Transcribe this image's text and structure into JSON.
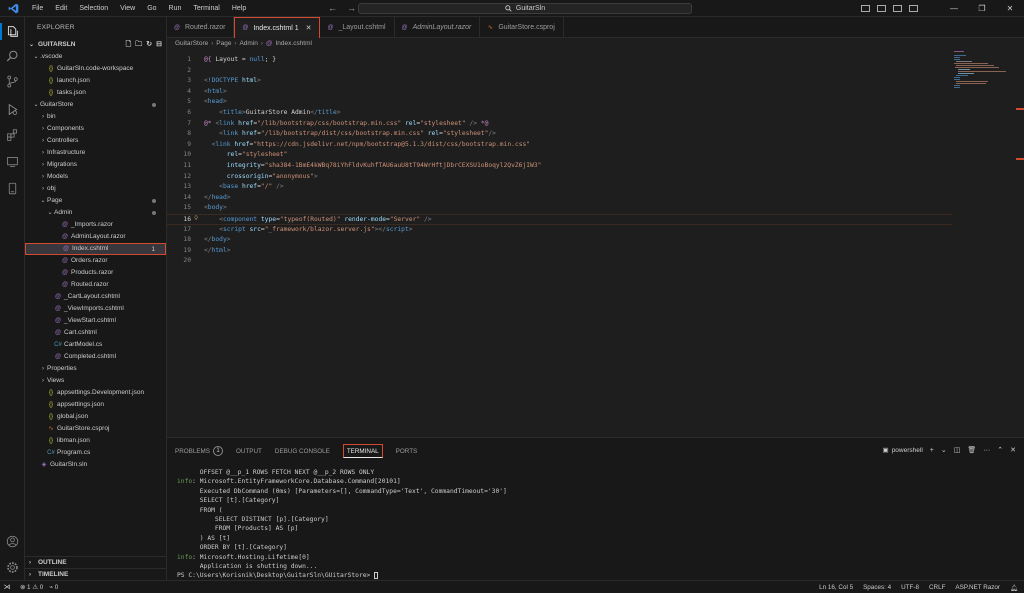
{
  "titlebar": {
    "menu": [
      "File",
      "Edit",
      "Selection",
      "View",
      "Go",
      "Run",
      "Terminal",
      "Help"
    ],
    "search_text": "GuitarSln"
  },
  "sidebar": {
    "title": "EXPLORER",
    "root": "GUITARSLN",
    "tree": [
      {
        "label": ".vscode",
        "depth": 1,
        "type": "folder-open"
      },
      {
        "label": "GuitarSln.code-workspace",
        "depth": 2,
        "type": "braces"
      },
      {
        "label": "launch.json",
        "depth": 2,
        "type": "braces"
      },
      {
        "label": "tasks.json",
        "depth": 2,
        "type": "braces"
      },
      {
        "label": "GuitarStore",
        "depth": 1,
        "type": "folder-open",
        "dot": true
      },
      {
        "label": "bin",
        "depth": 2,
        "type": "folder"
      },
      {
        "label": "Components",
        "depth": 2,
        "type": "folder"
      },
      {
        "label": "Controllers",
        "depth": 2,
        "type": "folder"
      },
      {
        "label": "Infrastructure",
        "depth": 2,
        "type": "folder"
      },
      {
        "label": "Migrations",
        "depth": 2,
        "type": "folder"
      },
      {
        "label": "Models",
        "depth": 2,
        "type": "folder"
      },
      {
        "label": "obj",
        "depth": 2,
        "type": "folder"
      },
      {
        "label": "Page",
        "depth": 2,
        "type": "folder-open",
        "dot": true
      },
      {
        "label": "Admin",
        "depth": 3,
        "type": "folder-open",
        "dot": true
      },
      {
        "label": "_Imports.razor",
        "depth": 4,
        "type": "file"
      },
      {
        "label": "AdminLayout.razor",
        "depth": 4,
        "type": "file"
      },
      {
        "label": "Index.cshtml",
        "depth": 4,
        "type": "file",
        "selected": true,
        "badge": "1"
      },
      {
        "label": "Orders.razor",
        "depth": 4,
        "type": "file"
      },
      {
        "label": "Products.razor",
        "depth": 4,
        "type": "file"
      },
      {
        "label": "Routed.razor",
        "depth": 4,
        "type": "file"
      },
      {
        "label": "_CartLayout.cshtml",
        "depth": 3,
        "type": "file"
      },
      {
        "label": "_ViewImports.cshtml",
        "depth": 3,
        "type": "file"
      },
      {
        "label": "_ViewStart.cshtml",
        "depth": 3,
        "type": "file"
      },
      {
        "label": "Cart.cshtml",
        "depth": 3,
        "type": "file"
      },
      {
        "label": "CartModel.cs",
        "depth": 3,
        "type": "cs"
      },
      {
        "label": "Completed.cshtml",
        "depth": 3,
        "type": "file"
      },
      {
        "label": "Properties",
        "depth": 2,
        "type": "folder"
      },
      {
        "label": "Views",
        "depth": 2,
        "type": "folder"
      },
      {
        "label": "appsettings.Development.json",
        "depth": 2,
        "type": "braces"
      },
      {
        "label": "appsettings.json",
        "depth": 2,
        "type": "braces"
      },
      {
        "label": "global.json",
        "depth": 2,
        "type": "braces"
      },
      {
        "label": "GuitarStore.csproj",
        "depth": 2,
        "type": "rss"
      },
      {
        "label": "libman.json",
        "depth": 2,
        "type": "braces"
      },
      {
        "label": "Program.cs",
        "depth": 2,
        "type": "cs"
      },
      {
        "label": "GuitarSln.sln",
        "depth": 1,
        "type": "sln"
      }
    ],
    "outline": "OUTLINE",
    "timeline": "TIMELINE"
  },
  "tabs": [
    {
      "label": "Routed.razor",
      "active": false,
      "italic": false
    },
    {
      "label": "Index.cshtml 1",
      "active": true,
      "italic": false
    },
    {
      "label": "_Layout.cshtml",
      "active": false,
      "italic": false
    },
    {
      "label": "AdminLayout.razor",
      "active": false,
      "italic": true
    },
    {
      "label": "GuitarStore.csproj",
      "active": false,
      "italic": false
    }
  ],
  "breadcrumb": [
    "GuitarStore",
    "Page",
    "Admin",
    "Index.cshtml"
  ],
  "editor": {
    "current_line": 16,
    "lines": [
      [
        [
          "raz",
          "@{ "
        ],
        [
          "t",
          "Layout = "
        ],
        [
          "kw",
          "null"
        ],
        [
          "t",
          "; }"
        ]
      ],
      [],
      [
        [
          "p",
          "<"
        ],
        [
          "tag",
          "!DOCTYPE"
        ],
        [
          "t",
          " "
        ],
        [
          "attr",
          "html"
        ],
        [
          "p",
          ">"
        ]
      ],
      [
        [
          "p",
          "<"
        ],
        [
          "tag",
          "html"
        ],
        [
          "p",
          ">"
        ]
      ],
      [
        [
          "p",
          "<"
        ],
        [
          "tag",
          "head"
        ],
        [
          "p",
          ">"
        ]
      ],
      [
        [
          "t",
          "    "
        ],
        [
          "p",
          "<"
        ],
        [
          "tag",
          "title"
        ],
        [
          "p",
          ">"
        ],
        [
          "t",
          "GuitarStore Admin"
        ],
        [
          "p",
          "</"
        ],
        [
          "tag",
          "title"
        ],
        [
          "p",
          ">"
        ]
      ],
      [
        [
          "raz",
          "@* "
        ],
        [
          "p",
          "<"
        ],
        [
          "tag",
          "link"
        ],
        [
          "t",
          " "
        ],
        [
          "attr",
          "href"
        ],
        [
          "t",
          "="
        ],
        [
          "str",
          "\"/lib/bootstrap/css/bootstrap.min.css\""
        ],
        [
          "t",
          " "
        ],
        [
          "attr",
          "rel"
        ],
        [
          "t",
          "="
        ],
        [
          "str",
          "\"stylesheet\""
        ],
        [
          "t",
          " "
        ],
        [
          "p",
          "/>"
        ],
        [
          "t",
          " "
        ],
        [
          "raz",
          "*@"
        ]
      ],
      [
        [
          "t",
          "    "
        ],
        [
          "p",
          "<"
        ],
        [
          "tag",
          "link"
        ],
        [
          "t",
          " "
        ],
        [
          "attr",
          "href"
        ],
        [
          "t",
          "="
        ],
        [
          "str",
          "\"/lib/bootstrap/dist/css/bootstrap.min.css\""
        ],
        [
          "t",
          " "
        ],
        [
          "attr",
          "rel"
        ],
        [
          "t",
          "="
        ],
        [
          "str",
          "\"stylesheet\""
        ],
        [
          "p",
          "/>"
        ]
      ],
      [
        [
          "t",
          "  "
        ],
        [
          "p",
          "<"
        ],
        [
          "tag",
          "link"
        ],
        [
          "t",
          " "
        ],
        [
          "attr",
          "href"
        ],
        [
          "t",
          "="
        ],
        [
          "str",
          "\"https://cdn.jsdelivr.net/npm/bootstrap@5.1.3/dist/css/bootstrap.min.css\""
        ]
      ],
      [
        [
          "t",
          "      "
        ],
        [
          "attr",
          "rel"
        ],
        [
          "t",
          "="
        ],
        [
          "str",
          "\"stylesheet\""
        ]
      ],
      [
        [
          "t",
          "      "
        ],
        [
          "attr",
          "integrity"
        ],
        [
          "t",
          "="
        ],
        [
          "str",
          "\"sha384-1BmE4kWBq78iYhFldvKuhfTAU6auU8tT94WrHftjDbrCEXSU1oBoqyl2QvZ6jIW3\""
        ]
      ],
      [
        [
          "t",
          "      "
        ],
        [
          "attr",
          "crossorigin"
        ],
        [
          "t",
          "="
        ],
        [
          "str",
          "\"anonymous\""
        ],
        [
          "p",
          ">"
        ]
      ],
      [
        [
          "t",
          "    "
        ],
        [
          "p",
          "<"
        ],
        [
          "tag",
          "base"
        ],
        [
          "t",
          " "
        ],
        [
          "attr",
          "href"
        ],
        [
          "t",
          "="
        ],
        [
          "str",
          "\"/\""
        ],
        [
          "t",
          " "
        ],
        [
          "p",
          "/>"
        ]
      ],
      [
        [
          "p",
          "</"
        ],
        [
          "tag",
          "head"
        ],
        [
          "p",
          ">"
        ]
      ],
      [
        [
          "p",
          "<"
        ],
        [
          "tag",
          "body"
        ],
        [
          "p",
          ">"
        ]
      ],
      [
        [
          "t",
          "    "
        ],
        [
          "p",
          "<"
        ],
        [
          "tag",
          "component"
        ],
        [
          "t",
          " "
        ],
        [
          "attr",
          "type"
        ],
        [
          "t",
          "="
        ],
        [
          "str",
          "\"typeof(Routed)\""
        ],
        [
          "t",
          " "
        ],
        [
          "attr",
          "render-mode"
        ],
        [
          "t",
          "="
        ],
        [
          "str",
          "\"Server\""
        ],
        [
          "t",
          " "
        ],
        [
          "p",
          "/>"
        ]
      ],
      [
        [
          "t",
          "    "
        ],
        [
          "p",
          "<"
        ],
        [
          "tag",
          "script"
        ],
        [
          "t",
          " "
        ],
        [
          "attr",
          "src"
        ],
        [
          "t",
          "="
        ],
        [
          "str",
          "\"_framework/blazor.server.js\""
        ],
        [
          "p",
          "></"
        ],
        [
          "tag",
          "script"
        ],
        [
          "p",
          ">"
        ]
      ],
      [
        [
          "p",
          "</"
        ],
        [
          "tag",
          "body"
        ],
        [
          "p",
          ">"
        ]
      ],
      [
        [
          "p",
          "</"
        ],
        [
          "tag",
          "html"
        ],
        [
          "p",
          ">"
        ]
      ],
      []
    ]
  },
  "panel": {
    "tabs": [
      {
        "label": "PROBLEMS",
        "count": "1",
        "active": false
      },
      {
        "label": "OUTPUT",
        "active": false
      },
      {
        "label": "DEBUG CONSOLE",
        "active": false
      },
      {
        "label": "TERMINAL",
        "active": true
      },
      {
        "label": "PORTS",
        "active": false
      }
    ],
    "shell": "powershell",
    "terminal_lines": [
      {
        "prefix": "",
        "text": "      OFFSET @__p_1 ROWS FETCH NEXT @__p_2 ROWS ONLY"
      },
      {
        "prefix": "info",
        "text": ": Microsoft.EntityFrameworkCore.Database.Command[20101]"
      },
      {
        "prefix": "",
        "text": "      Executed DbCommand (0ms) [Parameters=[], CommandType='Text', CommandTimeout='30']"
      },
      {
        "prefix": "",
        "text": "      SELECT [t].[Category]"
      },
      {
        "prefix": "",
        "text": "      FROM ("
      },
      {
        "prefix": "",
        "text": "          SELECT DISTINCT [p].[Category]"
      },
      {
        "prefix": "",
        "text": "          FROM [Products] AS [p]"
      },
      {
        "prefix": "",
        "text": "      ) AS [t]"
      },
      {
        "prefix": "",
        "text": "      ORDER BY [t].[Category]"
      },
      {
        "prefix": "info",
        "text": ": Microsoft.Hosting.Lifetime[0]"
      },
      {
        "prefix": "",
        "text": "      Application is shutting down..."
      },
      {
        "prefix": "",
        "text": "PS C:\\Users\\Korisnik\\Desktop\\GuitarSln\\GUitarStore> "
      }
    ]
  },
  "statusbar": {
    "errors": "1",
    "warnings": "0",
    "ports": "0",
    "position": "Ln 16, Col 5",
    "spaces": "Spaces: 4",
    "encoding": "UTF-8",
    "eol": "CRLF",
    "language": "ASP.NET Razor"
  },
  "colors": {
    "accent": "#d44a2f",
    "background": "#1e1e1e",
    "sidebar": "#181818"
  }
}
